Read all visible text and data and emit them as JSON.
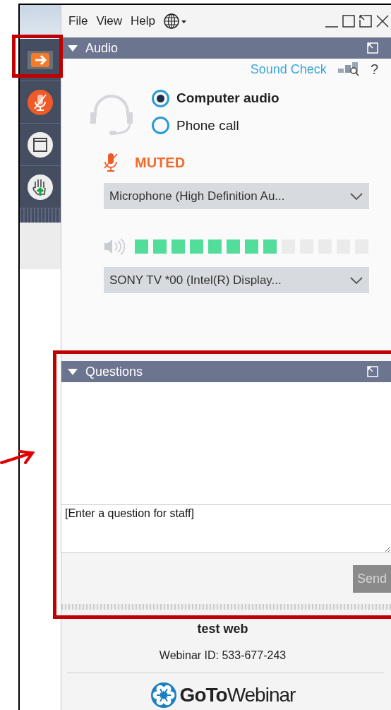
{
  "menu": [
    "File",
    "View",
    "Help"
  ],
  "sidebar": [
    {
      "kind": "collapse"
    },
    {
      "kind": "microphone"
    },
    {
      "kind": "screen"
    },
    {
      "kind": "hand"
    }
  ],
  "audio": {
    "title": "Audio",
    "sound_check": "Sound Check",
    "help": "?",
    "options": [
      {
        "label": "Computer audio",
        "selected": true
      },
      {
        "label": "Phone call",
        "selected": false
      }
    ],
    "mute_status": "MUTED",
    "microphone": "Microphone (High Definition Au...",
    "speaker_meter": {
      "level": 0.615
    },
    "speaker": "SONY TV  *00 (Intel(R) Display..."
  },
  "questions": {
    "title": "Questions",
    "placeholder": "[Enter a question for staff]",
    "send": "Send"
  },
  "footer": {
    "title": "test web",
    "webinar_id": "Webinar ID: 533-677-243",
    "logo": "**GoTo**Webinar"
  }
}
